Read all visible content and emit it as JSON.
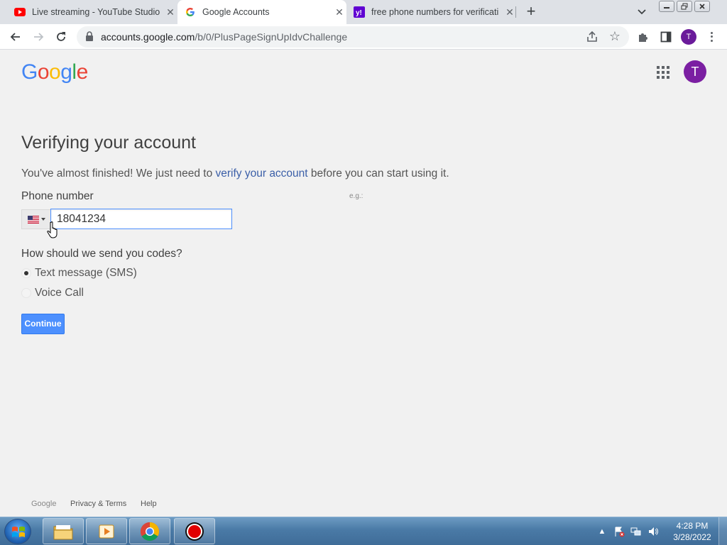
{
  "browser": {
    "tabs": [
      {
        "title": "Live streaming - YouTube Studio",
        "favicon": "youtube-icon",
        "active": false
      },
      {
        "title": "Google Accounts",
        "favicon": "google-icon",
        "active": true
      },
      {
        "title": "free phone numbers for verificati",
        "favicon": "yahoo-icon",
        "active": false
      }
    ],
    "url_host": "accounts.google.com",
    "url_path": "/b/0/PlusPageSignUpIdvChallenge",
    "profile_initial": "T"
  },
  "page": {
    "logo": [
      "G",
      "o",
      "o",
      "g",
      "l",
      "e"
    ],
    "avatar_initial": "T",
    "heading": "Verifying your account",
    "intro_before": "You've almost finished! We just need to ",
    "intro_link": "verify your account",
    "intro_after": " before you can start using it.",
    "phone_label": "Phone number",
    "phone_example": "e.g.:",
    "phone_value": "18041234",
    "country": "US",
    "send_question": "How should we send you codes?",
    "options": [
      {
        "label": "Text message (SMS)",
        "selected": true
      },
      {
        "label": "Voice Call",
        "selected": false
      }
    ],
    "continue_label": "Continue"
  },
  "footer": {
    "brand": "Google",
    "privacy": "Privacy & Terms",
    "help": "Help"
  },
  "taskbar": {
    "time": "4:28 PM",
    "date": "3/28/2022"
  },
  "colors": {
    "accent": "#4d90fe",
    "link": "#3b5fa8",
    "avatar": "#7b1fa2",
    "logo": [
      "#4285f4",
      "#ea4335",
      "#fbbc05",
      "#4285f4",
      "#34a853",
      "#ea4335"
    ]
  }
}
